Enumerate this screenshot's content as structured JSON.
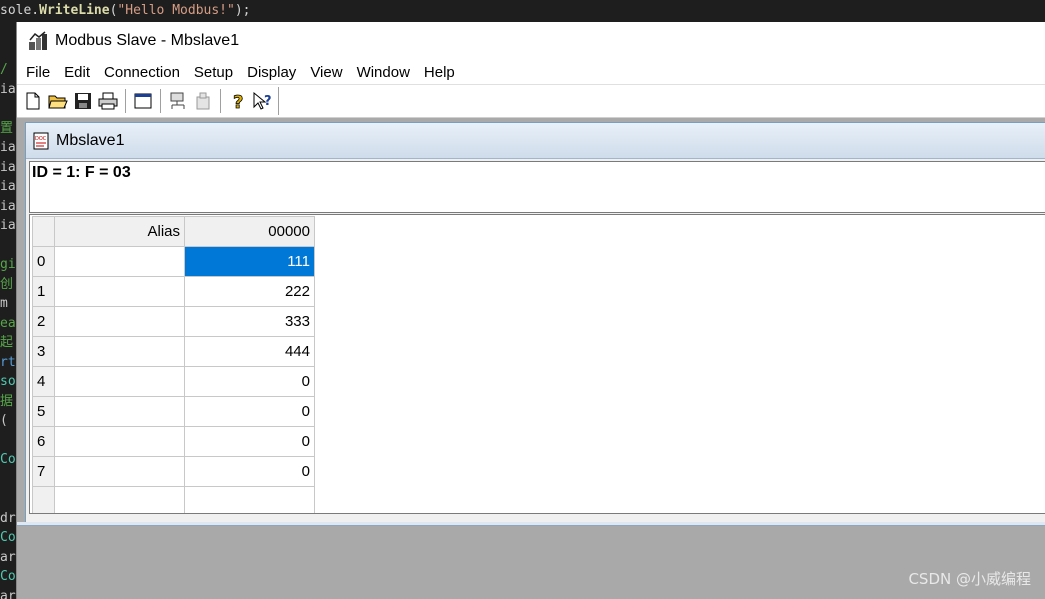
{
  "editor": {
    "top_prefix": "sole.",
    "top_method": "WriteLine",
    "top_open": "(",
    "top_string": "\"Hello Modbus!\"",
    "top_close": ");",
    "gutter": [
      {
        "t": "/ ",
        "c": "c-green"
      },
      {
        "t": "ia",
        "c": "c-grey"
      },
      {
        "t": "",
        "c": "c-grey"
      },
      {
        "t": "置",
        "c": "c-green"
      },
      {
        "t": "ia",
        "c": "c-grey"
      },
      {
        "t": "ia",
        "c": "c-grey"
      },
      {
        "t": "ia",
        "c": "c-grey"
      },
      {
        "t": "ia",
        "c": "c-grey"
      },
      {
        "t": "ia",
        "c": "c-grey"
      },
      {
        "t": "",
        "c": "c-grey"
      },
      {
        "t": "gi",
        "c": "c-green"
      },
      {
        "t": "创",
        "c": "c-green"
      },
      {
        "t": " m",
        "c": "c-grey"
      },
      {
        "t": "ea",
        "c": "c-green"
      },
      {
        "t": "起",
        "c": "c-green"
      },
      {
        "t": "rt",
        "c": "c-blue"
      },
      {
        "t": "so",
        "c": "c-teal"
      },
      {
        "t": "据",
        "c": "c-green"
      },
      {
        "t": " (",
        "c": "c-grey"
      },
      {
        "t": "",
        "c": "c-grey"
      },
      {
        "t": " Co",
        "c": "c-teal"
      },
      {
        "t": "",
        "c": "c-grey"
      },
      {
        "t": "",
        "c": "c-grey"
      },
      {
        "t": "dr",
        "c": "c-grey"
      },
      {
        "t": "Co",
        "c": "c-teal"
      },
      {
        "t": "ar",
        "c": "c-grey"
      },
      {
        "t": "Co",
        "c": "c-teal"
      },
      {
        "t": "ar",
        "c": "c-grey"
      }
    ]
  },
  "app": {
    "title": "Modbus Slave - Mbslave1",
    "menu": [
      "File",
      "Edit",
      "Connection",
      "Setup",
      "Display",
      "View",
      "Window",
      "Help"
    ]
  },
  "child": {
    "title": "Mbslave1",
    "id_line": "ID = 1: F = 03",
    "grid": {
      "alias_header": "Alias",
      "value_header": "00000",
      "rows": [
        {
          "index": "0",
          "alias": "",
          "value": "111",
          "selected": true
        },
        {
          "index": "1",
          "alias": "",
          "value": "222",
          "selected": false
        },
        {
          "index": "2",
          "alias": "",
          "value": "333",
          "selected": false
        },
        {
          "index": "3",
          "alias": "",
          "value": "444",
          "selected": false
        },
        {
          "index": "4",
          "alias": "",
          "value": "0",
          "selected": false
        },
        {
          "index": "5",
          "alias": "",
          "value": "0",
          "selected": false
        },
        {
          "index": "6",
          "alias": "",
          "value": "0",
          "selected": false
        },
        {
          "index": "7",
          "alias": "",
          "value": "0",
          "selected": false
        },
        {
          "index": "",
          "alias": "",
          "value": "",
          "selected": false
        }
      ]
    }
  },
  "watermark": "CSDN @小威编程",
  "colors": {
    "selection": "#0078d7",
    "mdi_background": "#a9a9a9"
  }
}
